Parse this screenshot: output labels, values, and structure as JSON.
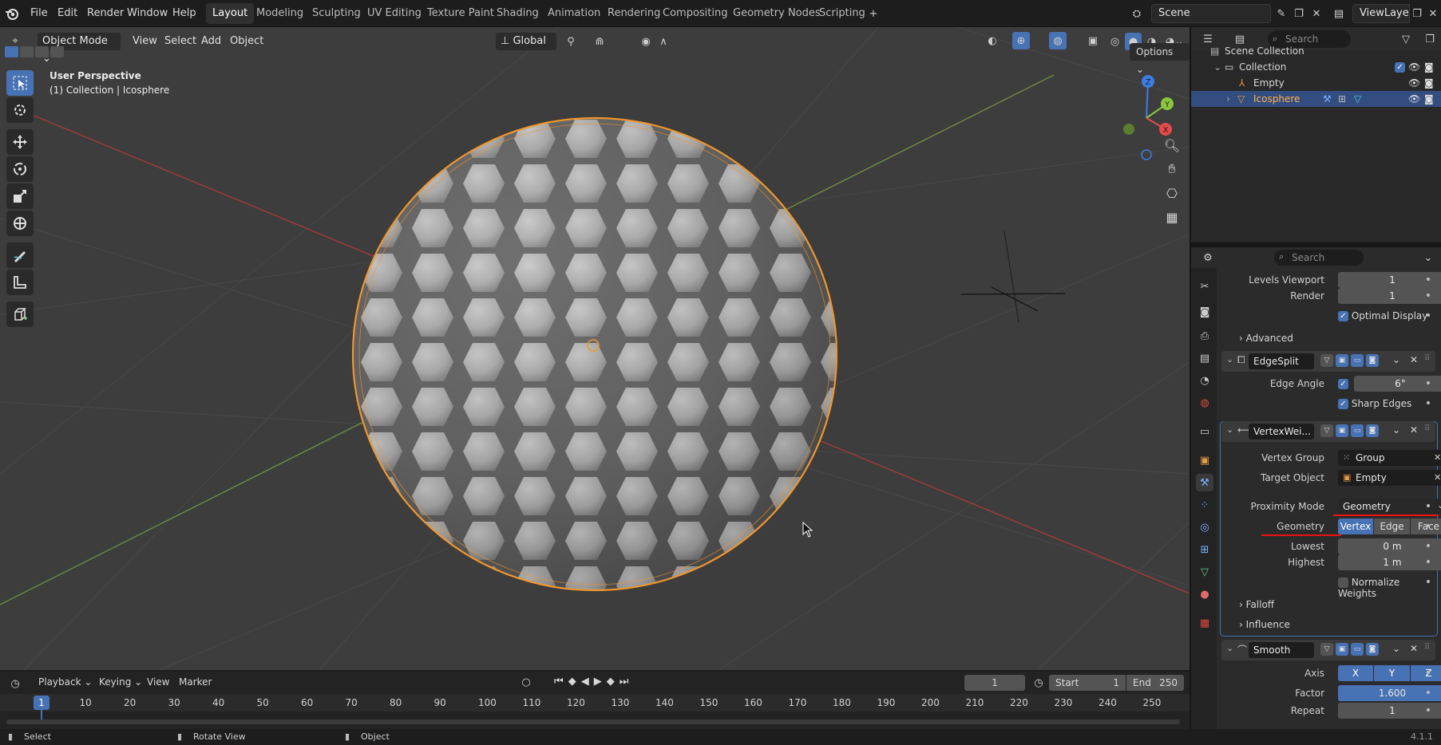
{
  "app": {
    "version": "4.1.1"
  },
  "topbar": {
    "menus": [
      "File",
      "Edit",
      "Render",
      "Window",
      "Help"
    ],
    "workspaces": [
      "Layout",
      "Modeling",
      "Sculpting",
      "UV Editing",
      "Texture Paint",
      "Shading",
      "Animation",
      "Rendering",
      "Compositing",
      "Geometry Nodes",
      "Scripting"
    ],
    "active_workspace": "Layout",
    "scene": "Scene",
    "view_layer": "ViewLayer"
  },
  "viewport": {
    "mode": "Object Mode",
    "menus": [
      "View",
      "Select",
      "Add",
      "Object"
    ],
    "transform_orientation": "Global",
    "options_label": "Options",
    "overlay_title": "User Perspective",
    "overlay_subtitle": "(1) Collection | Icosphere",
    "gizmo": {
      "x": "X",
      "y": "Y",
      "z": "Z"
    }
  },
  "outliner": {
    "search_placeholder": "Search",
    "items": [
      {
        "label": "Scene Collection"
      },
      {
        "label": "Collection"
      },
      {
        "label": "Empty"
      },
      {
        "label": "Icosphere",
        "selected": true
      }
    ]
  },
  "properties": {
    "search_placeholder": "Search",
    "subsurf": {
      "levels_viewport_label": "Levels Viewport",
      "levels_viewport": "1",
      "render_label": "Render",
      "render": "1",
      "optimal_display_label": "Optimal Display",
      "advanced_label": "Advanced"
    },
    "edgesplit": {
      "name": "EdgeSplit",
      "edge_angle_label": "Edge Angle",
      "edge_angle": "6°",
      "sharp_edges_label": "Sharp Edges"
    },
    "vertexweight": {
      "name": "VertexWei...",
      "vertex_group_label": "Vertex Group",
      "vertex_group": "Group",
      "target_object_label": "Target Object",
      "target_object": "Empty",
      "proximity_mode_label": "Proximity Mode",
      "proximity_mode": "Geometry",
      "geometry_label": "Geometry",
      "geometry_options": [
        "Vertex",
        "Edge",
        "Face"
      ],
      "lowest_label": "Lowest",
      "lowest": "0 m",
      "highest_label": "Highest",
      "highest": "1 m",
      "normalize_label": "Normalize Weights",
      "falloff_label": "Falloff",
      "influence_label": "Influence"
    },
    "smooth": {
      "name": "Smooth",
      "axis_label": "Axis",
      "axis": [
        "X",
        "Y",
        "Z"
      ],
      "factor_label": "Factor",
      "factor": "1.600",
      "repeat_label": "Repeat",
      "repeat": "1"
    }
  },
  "timeline": {
    "menus": [
      "Playback",
      "Keying",
      "View",
      "Marker"
    ],
    "current_frame": "1",
    "start_label": "Start",
    "start": "1",
    "end_label": "End",
    "end": "250",
    "ticks": [
      "10",
      "20",
      "30",
      "40",
      "50",
      "60",
      "70",
      "80",
      "90",
      "100",
      "110",
      "120",
      "130",
      "140",
      "150",
      "160",
      "170",
      "180",
      "190",
      "200",
      "210",
      "220",
      "230",
      "240",
      "250"
    ]
  },
  "statusbar": {
    "select": "Select",
    "rotate": "Rotate View",
    "object": "Object"
  }
}
